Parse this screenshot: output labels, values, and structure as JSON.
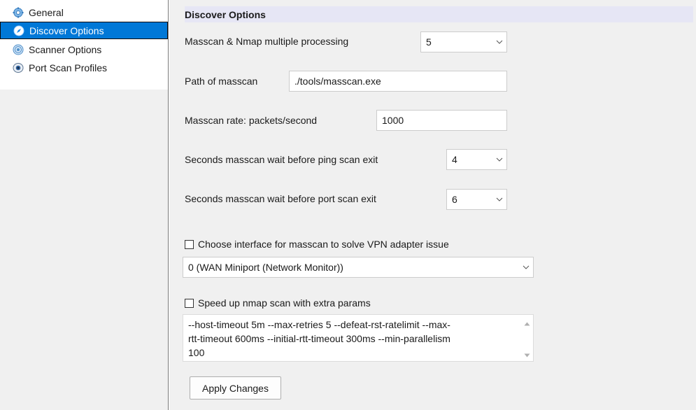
{
  "sidebar": {
    "items": [
      {
        "label": "General",
        "icon": "gear-icon"
      },
      {
        "label": "Discover Options",
        "icon": "compass-icon",
        "selected": true
      },
      {
        "label": "Scanner Options",
        "icon": "radar-icon"
      },
      {
        "label": "Port Scan Profiles",
        "icon": "eye-icon"
      }
    ]
  },
  "main": {
    "header": "Discover Options",
    "multiprocess": {
      "label": "Masscan & Nmap multiple processing",
      "value": "5"
    },
    "path": {
      "label": "Path of masscan",
      "value": "./tools/masscan.exe"
    },
    "rate": {
      "label": "Masscan rate: packets/second",
      "value": "1000"
    },
    "ping_wait": {
      "label": "Seconds masscan wait before ping scan exit",
      "value": "4"
    },
    "port_wait": {
      "label": "Seconds masscan wait before port scan exit",
      "value": "6"
    },
    "interface_check": {
      "label": "Choose interface for masscan to solve VPN adapter issue",
      "checked": false
    },
    "interface_select": {
      "value": "0 (WAN Miniport (Network Monitor))"
    },
    "speedup_check": {
      "label": "Speed up nmap scan with extra params",
      "checked": false
    },
    "extra_params": {
      "lines": [
        "--host-timeout 5m --max-retries 5 --defeat-rst-ratelimit --max-",
        "rtt-timeout 600ms --initial-rtt-timeout 300ms --min-parallelism",
        "100"
      ]
    },
    "apply_button": "Apply Changes"
  },
  "colors": {
    "selection": "#0078d7",
    "header_bg": "#e6e6f5",
    "panel_bg": "#f0f0f0"
  }
}
